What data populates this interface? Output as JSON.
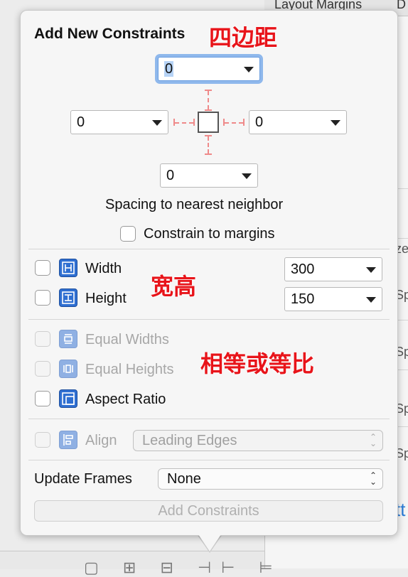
{
  "background": {
    "header_labels": [
      "Layout Margins",
      "D"
    ],
    "fragments": [
      "ze",
      "Sp",
      "Sp",
      "Sp",
      "Sp"
    ],
    "blue_fragment": "tt"
  },
  "popover": {
    "title": "Add New Constraints",
    "annotations": {
      "margins": "四边距",
      "size": "宽高",
      "equal": "相等或等比"
    },
    "spacing": {
      "top": "0",
      "left": "0",
      "right": "0",
      "bottom": "0",
      "caption": "Spacing to nearest neighbor",
      "constrain_margins_label": "Constrain to margins"
    },
    "size": {
      "width_label": "Width",
      "width_value": "300",
      "height_label": "Height",
      "height_value": "150"
    },
    "relations": {
      "equal_widths": "Equal Widths",
      "equal_heights": "Equal Heights",
      "aspect_ratio": "Aspect Ratio"
    },
    "align": {
      "label": "Align",
      "value": "Leading Edges"
    },
    "update_frames": {
      "label": "Update Frames",
      "value": "None"
    },
    "add_button": "Add Constraints"
  }
}
